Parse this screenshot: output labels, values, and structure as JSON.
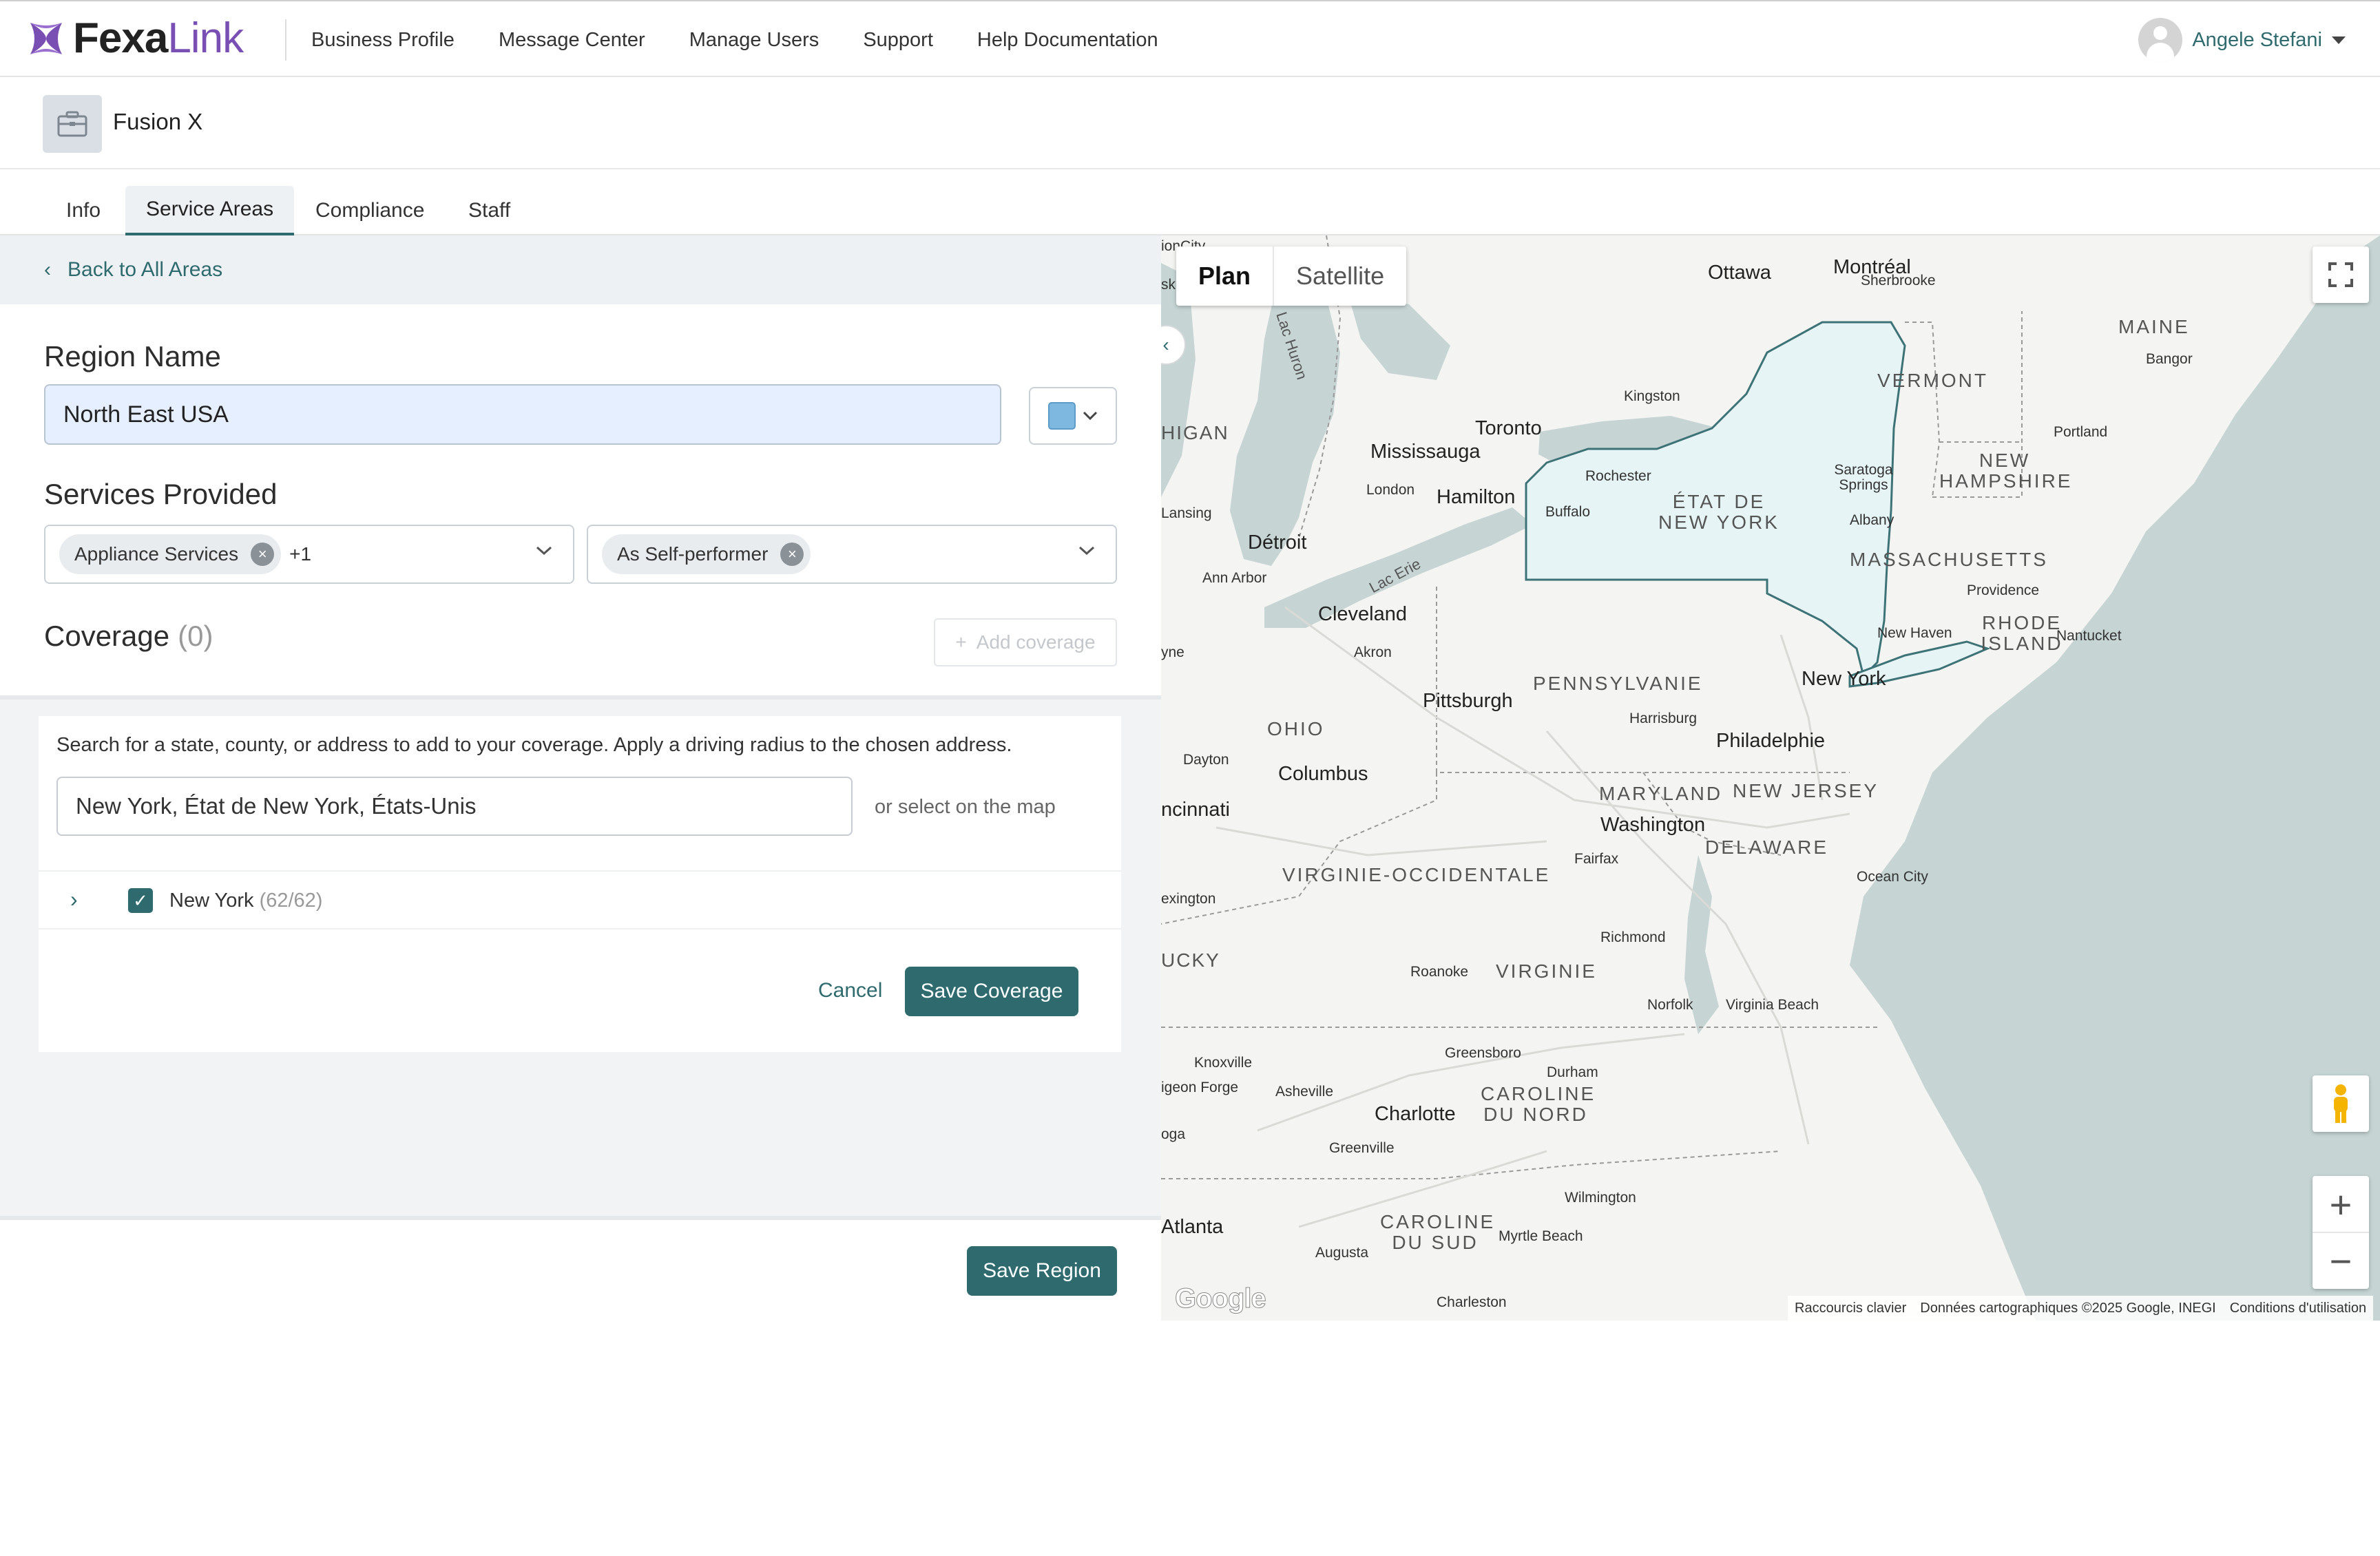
{
  "brand": {
    "name_part1": "Fexa",
    "name_part2": "Link"
  },
  "nav": {
    "items": [
      "Business Profile",
      "Message Center",
      "Manage Users",
      "Support",
      "Help Documentation"
    ]
  },
  "user": {
    "name": "Angele Stefani"
  },
  "company": {
    "name": "Fusion X"
  },
  "tabs": [
    "Info",
    "Service Areas",
    "Compliance",
    "Staff"
  ],
  "active_tab": "Service Areas",
  "back_link": "Back to All Areas",
  "region": {
    "label": "Region Name",
    "value": "North East USA",
    "color": "#7eb8e0"
  },
  "services": {
    "label": "Services Provided",
    "selected_service": "Appliance Services",
    "more_count": "+1",
    "selected_role": "As Self-performer"
  },
  "coverage": {
    "title": "Coverage",
    "count": "(0)",
    "add_label": "Add coverage",
    "help_text": "Search for a state, county, or address to add to your coverage. Apply a driving radius to the chosen address.",
    "search_value": "New York, État de New York, États-Unis",
    "or_select": "or select on the map",
    "results": [
      {
        "name": "New York",
        "count": "(62/62)",
        "checked": true
      }
    ],
    "cancel_label": "Cancel",
    "save_label": "Save Coverage"
  },
  "save_region_label": "Save Region",
  "map": {
    "type_plan": "Plan",
    "type_satellite": "Satellite",
    "selected_fill": "#e6f4f5",
    "selected_stroke": "#3d7276",
    "water_color": "#c6d5d4",
    "cities_large": [
      "Ottawa",
      "Montréal",
      "Toronto",
      "Mississauga",
      "Hamilton",
      "Détroit",
      "Cleveland",
      "Pittsburgh",
      "New York",
      "Philadelphie",
      "Washington",
      "Columbus",
      "Charlotte",
      "Atlanta"
    ],
    "cities_small": [
      "Sherbrooke",
      "Kingston",
      "Bangor",
      "Portland",
      "Rochester",
      "Buffalo",
      "London",
      "Lansing",
      "Ann Arbor",
      "Akron",
      "Albany",
      "Saratoga Springs",
      "Providence",
      "New Haven",
      "Nantucket",
      "Harrisburg",
      "Dayton",
      "Fairfax",
      "Ocean City",
      "Richmond",
      "Roanoke",
      "Norfolk",
      "Virginia Beach",
      "Greensboro",
      "Durham",
      "Knoxville",
      "Asheville",
      "Greenville",
      "Wilmington",
      "Myrtle Beach",
      "Augusta",
      "Charleston"
    ],
    "cut_labels": [
      "sk",
      "HIGAN",
      "yne",
      "ncinnati",
      "exington",
      "UCKY",
      "igeon Forge",
      "oga",
      "ionCity"
    ],
    "states": [
      "MAINE",
      "VERMONT",
      "NEW HAMPSHIRE",
      "ÉTAT DE NEW YORK",
      "MASSACHUSETTS",
      "RHODE ISLAND",
      "PENNSYLVANIE",
      "OHIO",
      "MARYLAND",
      "NEW JERSEY",
      "DELAWARE",
      "VIRGINIE-OCCIDENTALE",
      "VIRGINIE",
      "CAROLINE DU NORD",
      "CAROLINE DU SUD"
    ],
    "water": [
      "Lac Huron",
      "Lac Erie"
    ],
    "attribution": [
      "Raccourcis clavier",
      "Données cartographiques ©2025 Google, INEGI",
      "Conditions d'utilisation"
    ],
    "google": "Google"
  }
}
